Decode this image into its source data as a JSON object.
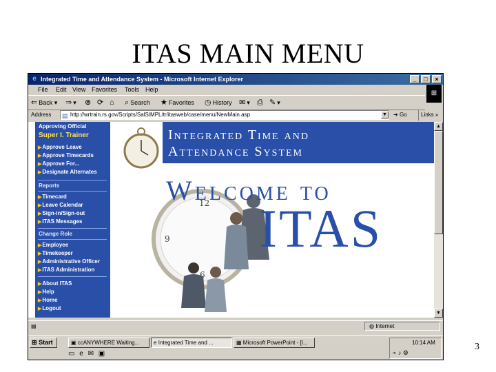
{
  "slide": {
    "title": "ITAS MAIN MENU",
    "page_number": "3"
  },
  "window": {
    "title": "Integrated Time and Attendance System - Microsoft Internet Explorer",
    "controls": [
      "_",
      "□",
      "×"
    ]
  },
  "menubar": {
    "items": [
      "File",
      "Edit",
      "View",
      "Favorites",
      "Tools",
      "Help"
    ]
  },
  "toolbar": {
    "back": "Back",
    "search": "Search",
    "favorites": "Favorites",
    "history": "History"
  },
  "address": {
    "label": "Address",
    "url": "http://wrtrain.rs.gov/Scripts/SalSIMPL/tr/itasweb/case/menu/NewMain.asp",
    "go": "Go",
    "links": "Links"
  },
  "sidebar": {
    "role_label": "Approving Official",
    "user_name": "Super I. Trainer",
    "approve_items": [
      "Approve Leave",
      "Approve Timecards",
      "Approve For...",
      "Designate Alternates"
    ],
    "reports_label": "Reports",
    "report_items": [
      "Timecard",
      "Leave Calendar",
      "Sign-in/Sign-out",
      "ITAS Messages"
    ],
    "change_role_label": "Change Role",
    "role_items": [
      "Employee",
      "Timekeeper",
      "Administrative Officer",
      "ITAS Administration"
    ],
    "help_items": [
      "About ITAS",
      "Help",
      "Home",
      "Logout"
    ]
  },
  "banner": {
    "line1": "Integrated Time and",
    "line2": "Attendance System",
    "welcome": "Welcome to",
    "logo": "ITAS"
  },
  "statusbar": {
    "zone": "Internet"
  },
  "taskbar": {
    "start": "Start",
    "tasks": [
      "ccANYWHERE Waiting...",
      "Integrated Time and ...",
      "Microsoft PowerPoint - [I..."
    ],
    "clock": "10:14 AM"
  },
  "colors": {
    "brand_blue": "#2a4fa8",
    "title_bar": "#0a246a",
    "highlight_yellow": "#ffe34d"
  }
}
